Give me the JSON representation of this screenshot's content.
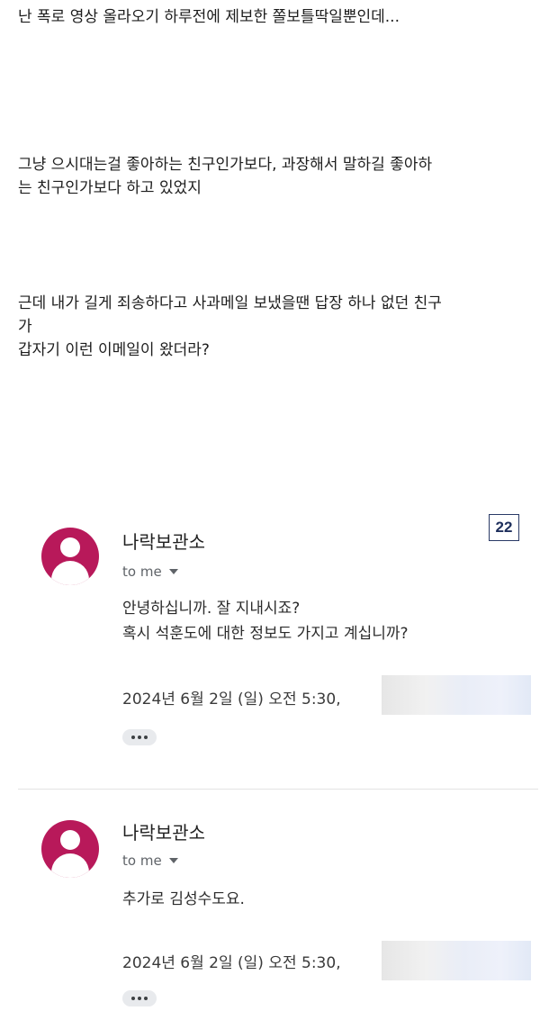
{
  "post": {
    "paragraphs": [
      "난 폭로 영상 올라오기 하루전에 제보한 쫄보틀딱일뿐인데...",
      "그냥 으시대는걸 좋아하는 친구인가보다, 과장해서 말하길 좋아하\n는 친구인가보다 하고 있었지",
      "근데 내가 길게 죄송하다고 사과메일 보냈을땐 답장 하나 없던 친구\n가\n갑자기 이런 이메일이 왔더라?"
    ]
  },
  "page_badge": "22",
  "emails": [
    {
      "sender": "나락보관소",
      "recipient": "to me",
      "body": "안녕하십니까. 잘 지내시죠?\n혹시 석훈도에 대한 정보도 가지고 계십니까?",
      "date": "2024년 6월 2일 (일) 오전 5:30,"
    },
    {
      "sender": "나락보관소",
      "recipient": "to me",
      "body": "추가로 김성수도요.",
      "date": "2024년 6월 2일 (일) 오전 5:30,"
    }
  ],
  "colors": {
    "avatar": "#b8195a",
    "badge_border": "#2a3a66"
  }
}
